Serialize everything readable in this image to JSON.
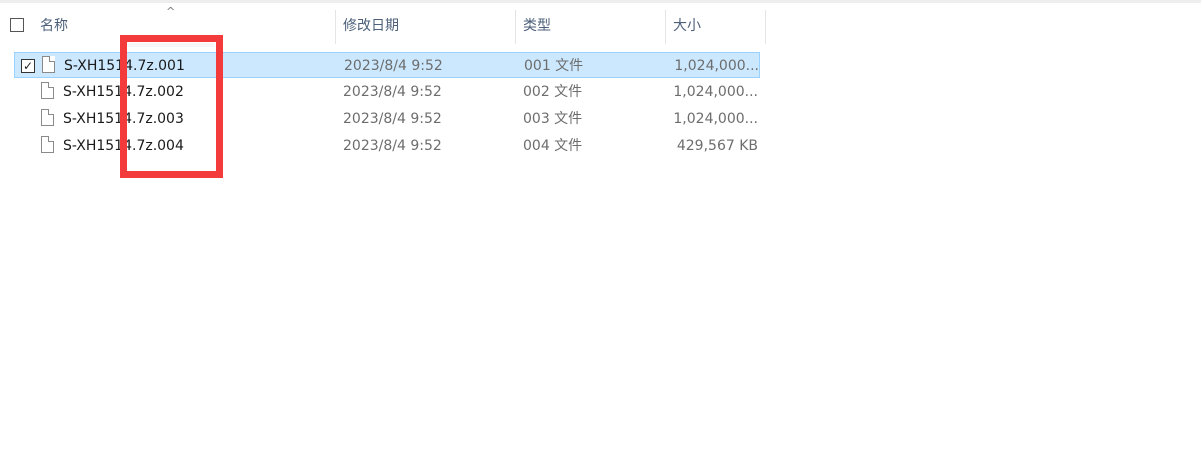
{
  "header": {
    "sort_arrow": "^",
    "columns": [
      {
        "key": "name",
        "label": "名称"
      },
      {
        "key": "date",
        "label": "修改日期"
      },
      {
        "key": "type",
        "label": "类型"
      },
      {
        "key": "size",
        "label": "大小"
      }
    ]
  },
  "files": [
    {
      "name": "S-XH1514.7z.001",
      "date": "2023/8/4 9:52",
      "type": "001 文件",
      "size": "1,024,000...",
      "selected": true,
      "check": "✓"
    },
    {
      "name": "S-XH1514.7z.002",
      "date": "2023/8/4 9:52",
      "type": "002 文件",
      "size": "1,024,000...",
      "selected": false
    },
    {
      "name": "S-XH1514.7z.003",
      "date": "2023/8/4 9:52",
      "type": "003 文件",
      "size": "1,024,000...",
      "selected": false
    },
    {
      "name": "S-XH1514.7z.004",
      "date": "2023/8/4 9:52",
      "type": "004 文件",
      "size": "429,567 KB",
      "selected": false
    }
  ],
  "icons": {
    "file": "document-icon",
    "checkbox": "checkbox-icon",
    "sort": "sort-ascending-icon"
  },
  "colors": {
    "selection_bg": "#cce8ff",
    "selection_border": "#99d1ff",
    "header_text": "#4c607a",
    "annotation": "#f33b3b"
  }
}
